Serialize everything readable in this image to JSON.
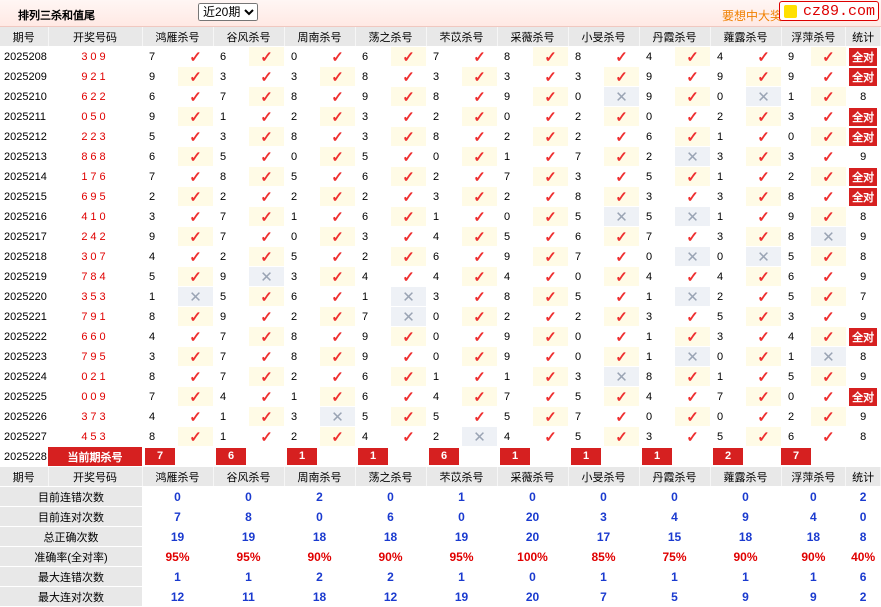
{
  "toolbar": {
    "title": "排列三杀和值尾",
    "period_select": "近20期",
    "period_options": [
      "近20期"
    ],
    "promo": "要想中大奖",
    "site_badge": "cz89.com"
  },
  "columns": [
    "期号",
    "开奖号码",
    "鸿雁杀号",
    "谷风杀号",
    "周南杀号",
    "荡之杀号",
    "芣苡杀号",
    "采薇杀号",
    "小旻杀号",
    "丹霞杀号",
    "蕹露杀号",
    "浮萍杀号",
    "统计"
  ],
  "rows": [
    {
      "period": "2025208",
      "winning": "309",
      "kills": [
        7,
        6,
        0,
        6,
        7,
        8,
        8,
        4,
        4,
        9
      ],
      "hits": [
        1,
        1,
        1,
        1,
        1,
        1,
        1,
        1,
        1,
        1
      ],
      "total": "全对"
    },
    {
      "period": "2025209",
      "winning": "921",
      "kills": [
        9,
        3,
        3,
        8,
        3,
        3,
        3,
        9,
        9,
        9
      ],
      "hits": [
        1,
        1,
        1,
        1,
        1,
        1,
        1,
        1,
        1,
        1
      ],
      "total": "全对"
    },
    {
      "period": "2025210",
      "winning": "622",
      "kills": [
        6,
        7,
        8,
        9,
        8,
        9,
        0,
        9,
        0,
        1
      ],
      "hits": [
        1,
        1,
        1,
        1,
        1,
        1,
        0,
        1,
        0,
        1
      ],
      "total": "8"
    },
    {
      "period": "2025211",
      "winning": "050",
      "kills": [
        9,
        1,
        2,
        3,
        2,
        0,
        2,
        0,
        2,
        3
      ],
      "hits": [
        1,
        1,
        1,
        1,
        1,
        1,
        1,
        1,
        1,
        1
      ],
      "total": "全对"
    },
    {
      "period": "2025212",
      "winning": "223",
      "kills": [
        5,
        3,
        8,
        3,
        8,
        2,
        2,
        6,
        1,
        0
      ],
      "hits": [
        1,
        1,
        1,
        1,
        1,
        1,
        1,
        1,
        1,
        1
      ],
      "total": "全对"
    },
    {
      "period": "2025213",
      "winning": "868",
      "kills": [
        6,
        5,
        0,
        5,
        0,
        1,
        7,
        2,
        3,
        3
      ],
      "hits": [
        1,
        1,
        1,
        1,
        1,
        1,
        1,
        0,
        1,
        1
      ],
      "total": "9"
    },
    {
      "period": "2025214",
      "winning": "176",
      "kills": [
        7,
        8,
        5,
        6,
        2,
        7,
        3,
        5,
        1,
        2
      ],
      "hits": [
        1,
        1,
        1,
        1,
        1,
        1,
        1,
        1,
        1,
        1
      ],
      "total": "全对"
    },
    {
      "period": "2025215",
      "winning": "695",
      "kills": [
        2,
        2,
        2,
        2,
        3,
        2,
        8,
        3,
        3,
        8
      ],
      "hits": [
        1,
        1,
        1,
        1,
        1,
        1,
        1,
        1,
        1,
        1
      ],
      "total": "全对"
    },
    {
      "period": "2025216",
      "winning": "410",
      "kills": [
        3,
        7,
        1,
        6,
        1,
        0,
        5,
        5,
        1,
        9
      ],
      "hits": [
        1,
        1,
        1,
        1,
        1,
        1,
        0,
        0,
        1,
        1
      ],
      "total": "8"
    },
    {
      "period": "2025217",
      "winning": "242",
      "kills": [
        9,
        7,
        0,
        3,
        4,
        5,
        6,
        7,
        3,
        8
      ],
      "hits": [
        1,
        1,
        1,
        1,
        1,
        1,
        1,
        1,
        1,
        0
      ],
      "total": "9"
    },
    {
      "period": "2025218",
      "winning": "307",
      "kills": [
        4,
        2,
        5,
        2,
        6,
        9,
        7,
        0,
        0,
        5
      ],
      "hits": [
        1,
        1,
        1,
        1,
        1,
        1,
        1,
        0,
        0,
        1
      ],
      "total": "8"
    },
    {
      "period": "2025219",
      "winning": "784",
      "kills": [
        5,
        9,
        3,
        4,
        4,
        4,
        0,
        4,
        4,
        6
      ],
      "hits": [
        1,
        0,
        1,
        1,
        1,
        1,
        1,
        1,
        1,
        1
      ],
      "total": "9"
    },
    {
      "period": "2025220",
      "winning": "353",
      "kills": [
        1,
        5,
        6,
        1,
        3,
        8,
        5,
        1,
        2,
        5
      ],
      "hits": [
        0,
        1,
        1,
        0,
        1,
        1,
        1,
        0,
        1,
        1
      ],
      "total": "7"
    },
    {
      "period": "2025221",
      "winning": "791",
      "kills": [
        8,
        9,
        2,
        7,
        0,
        2,
        2,
        3,
        5,
        3
      ],
      "hits": [
        1,
        1,
        1,
        0,
        1,
        1,
        1,
        1,
        1,
        1
      ],
      "total": "9"
    },
    {
      "period": "2025222",
      "winning": "660",
      "kills": [
        4,
        7,
        8,
        9,
        0,
        9,
        0,
        1,
        3,
        4
      ],
      "hits": [
        1,
        1,
        1,
        1,
        1,
        1,
        1,
        1,
        1,
        1
      ],
      "total": "全对"
    },
    {
      "period": "2025223",
      "winning": "795",
      "kills": [
        3,
        7,
        8,
        9,
        0,
        9,
        0,
        1,
        0,
        1
      ],
      "hits": [
        1,
        1,
        1,
        1,
        1,
        1,
        1,
        0,
        1,
        0
      ],
      "total": "8"
    },
    {
      "period": "2025224",
      "winning": "021",
      "kills": [
        8,
        7,
        2,
        6,
        1,
        1,
        3,
        8,
        1,
        5
      ],
      "hits": [
        1,
        1,
        1,
        1,
        1,
        1,
        0,
        1,
        1,
        1
      ],
      "total": "9"
    },
    {
      "period": "2025225",
      "winning": "009",
      "kills": [
        7,
        4,
        1,
        6,
        4,
        7,
        5,
        4,
        7,
        0
      ],
      "hits": [
        1,
        1,
        1,
        1,
        1,
        1,
        1,
        1,
        1,
        1
      ],
      "total": "全对"
    },
    {
      "period": "2025226",
      "winning": "373",
      "kills": [
        4,
        1,
        3,
        5,
        5,
        5,
        7,
        0,
        0,
        2
      ],
      "hits": [
        1,
        1,
        0,
        1,
        1,
        1,
        1,
        1,
        1,
        1
      ],
      "total": "9"
    },
    {
      "period": "2025227",
      "winning": "453",
      "kills": [
        8,
        1,
        2,
        4,
        2,
        4,
        5,
        3,
        5,
        6
      ],
      "hits": [
        1,
        1,
        1,
        1,
        0,
        1,
        1,
        1,
        1,
        1
      ],
      "total": "8"
    }
  ],
  "current": {
    "period": "2025228",
    "label": "当前期杀号",
    "kills": [
      7,
      6,
      1,
      1,
      6,
      1,
      1,
      1,
      2,
      7
    ]
  },
  "stats": [
    {
      "label": "目前连错次数",
      "values": [
        "0",
        "0",
        "2",
        "0",
        "1",
        "0",
        "0",
        "0",
        "0",
        "0"
      ],
      "total": "2",
      "kind": "v"
    },
    {
      "label": "目前连对次数",
      "values": [
        "7",
        "8",
        "0",
        "6",
        "0",
        "20",
        "3",
        "4",
        "9",
        "4"
      ],
      "total": "0",
      "kind": "v"
    },
    {
      "label": "总正确次数",
      "values": [
        "19",
        "19",
        "18",
        "18",
        "19",
        "20",
        "17",
        "15",
        "18",
        "18"
      ],
      "total": "8",
      "kind": "v"
    },
    {
      "label": "准确率(全对率)",
      "values": [
        "95%",
        "95%",
        "90%",
        "90%",
        "95%",
        "100%",
        "85%",
        "75%",
        "90%",
        "90%"
      ],
      "total": "40%",
      "kind": "pct"
    },
    {
      "label": "最大连错次数",
      "values": [
        "1",
        "1",
        "2",
        "2",
        "1",
        "0",
        "1",
        "1",
        "1",
        "1"
      ],
      "total": "6",
      "kind": "v"
    },
    {
      "label": "最大连对次数",
      "values": [
        "12",
        "11",
        "18",
        "12",
        "19",
        "20",
        "7",
        "5",
        "9",
        "9"
      ],
      "total": "2",
      "kind": "v"
    }
  ],
  "icons": {
    "hit": "check-mark-icon",
    "miss": "cross-mark-icon"
  },
  "colors": {
    "accent": "#d62020",
    "stat_value": "#1a3acf",
    "winning_number": "#e00000"
  }
}
